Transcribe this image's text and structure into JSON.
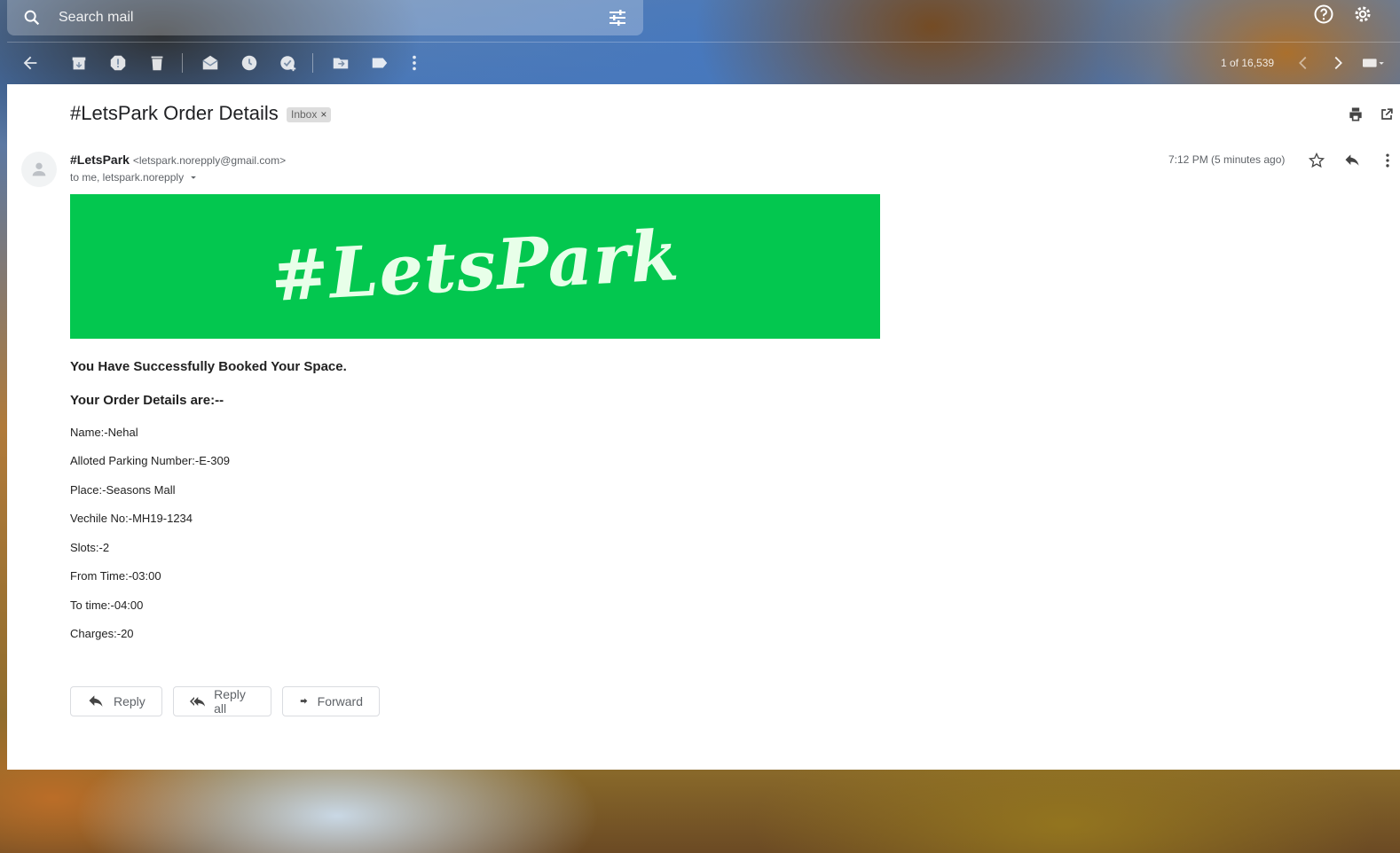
{
  "search": {
    "placeholder": "Search mail"
  },
  "toolbar": {
    "pager": "1 of 16,539"
  },
  "email": {
    "subject": "#LetsPark Order Details",
    "label": "Inbox",
    "label_remove": "×",
    "sender_name": "#LetsPark",
    "sender_email": "<letspark.norepply@gmail.com>",
    "to": "to me, letspark.norepply",
    "time": "7:12 PM (5 minutes ago)",
    "banner_text": "#LetsPark",
    "heading1": "You Have Successfully Booked Your Space.",
    "heading2": "Your Order Details are:--",
    "details": [
      "Name:-Nehal",
      "Alloted Parking Number:-E-309",
      "Place:-Seasons Mall",
      "Vechile No:-MH19-1234",
      "Slots:-2",
      "From Time:-03:00",
      "To time:-04:00",
      "Charges:-20"
    ]
  },
  "actions": {
    "reply": "Reply",
    "reply_all": "Reply all",
    "forward": "Forward"
  },
  "colors": {
    "banner": "#03c74f"
  }
}
